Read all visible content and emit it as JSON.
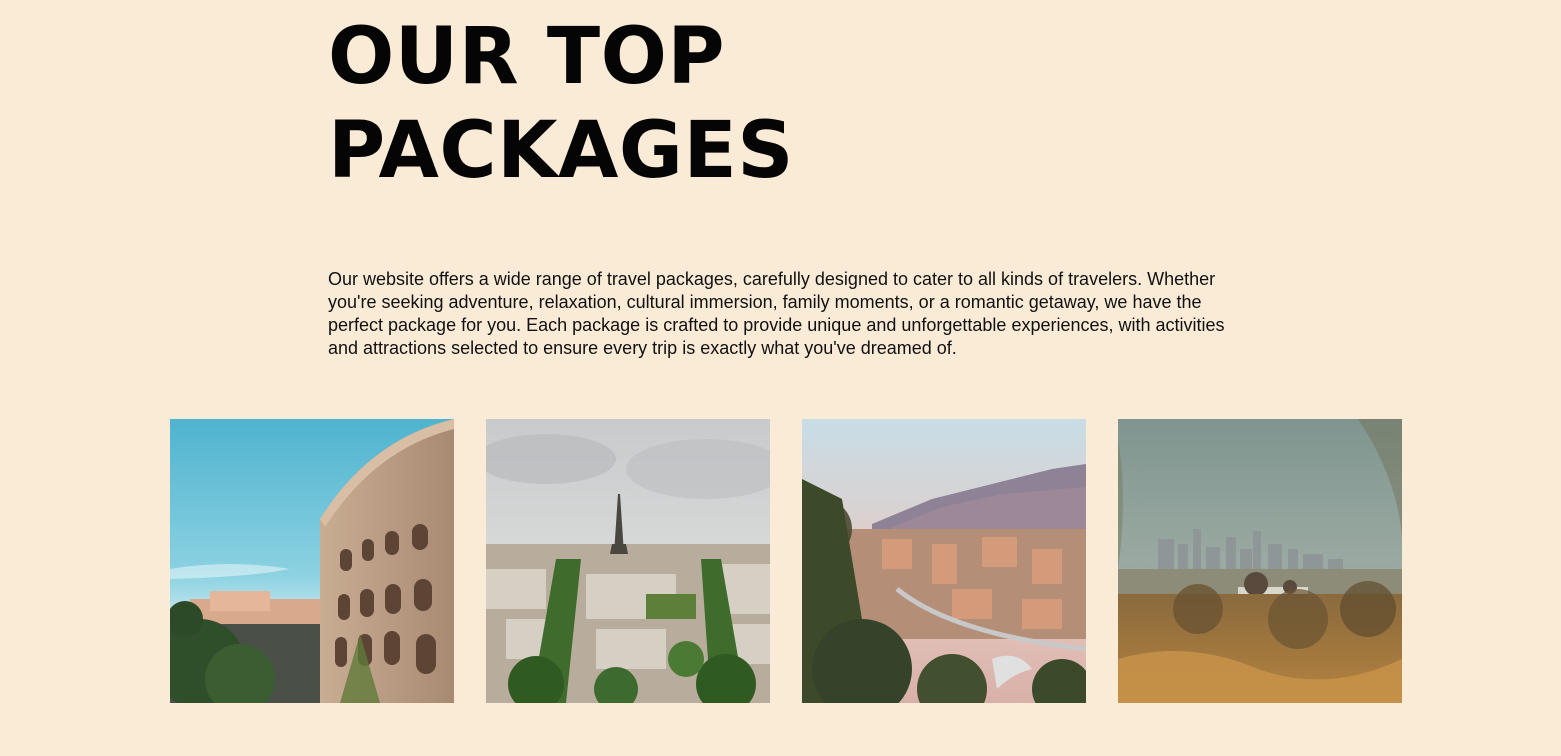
{
  "header": {
    "title_line1": "OUR TOP",
    "title_line2": "PACKAGES"
  },
  "intro": {
    "text": "Our website offers a wide range of travel packages, carefully designed to cater to all kinds of travelers. Whether you're seeking adventure, relaxation, cultural immersion, family moments, or a romantic getaway, we have the perfect package for you. Each package is crafted to provide unique and unforgettable experiences, with activities and attractions selected to ensure every trip is exactly what you've dreamed of."
  },
  "packages": [
    {
      "image": "colosseum-photo"
    },
    {
      "image": "paris-eiffel-tower-photo"
    },
    {
      "image": "mountain-city-photo"
    },
    {
      "image": "los-angeles-skyline-photo"
    }
  ],
  "colors": {
    "background": "#faebd7",
    "title": "#050505",
    "text": "#111111"
  }
}
